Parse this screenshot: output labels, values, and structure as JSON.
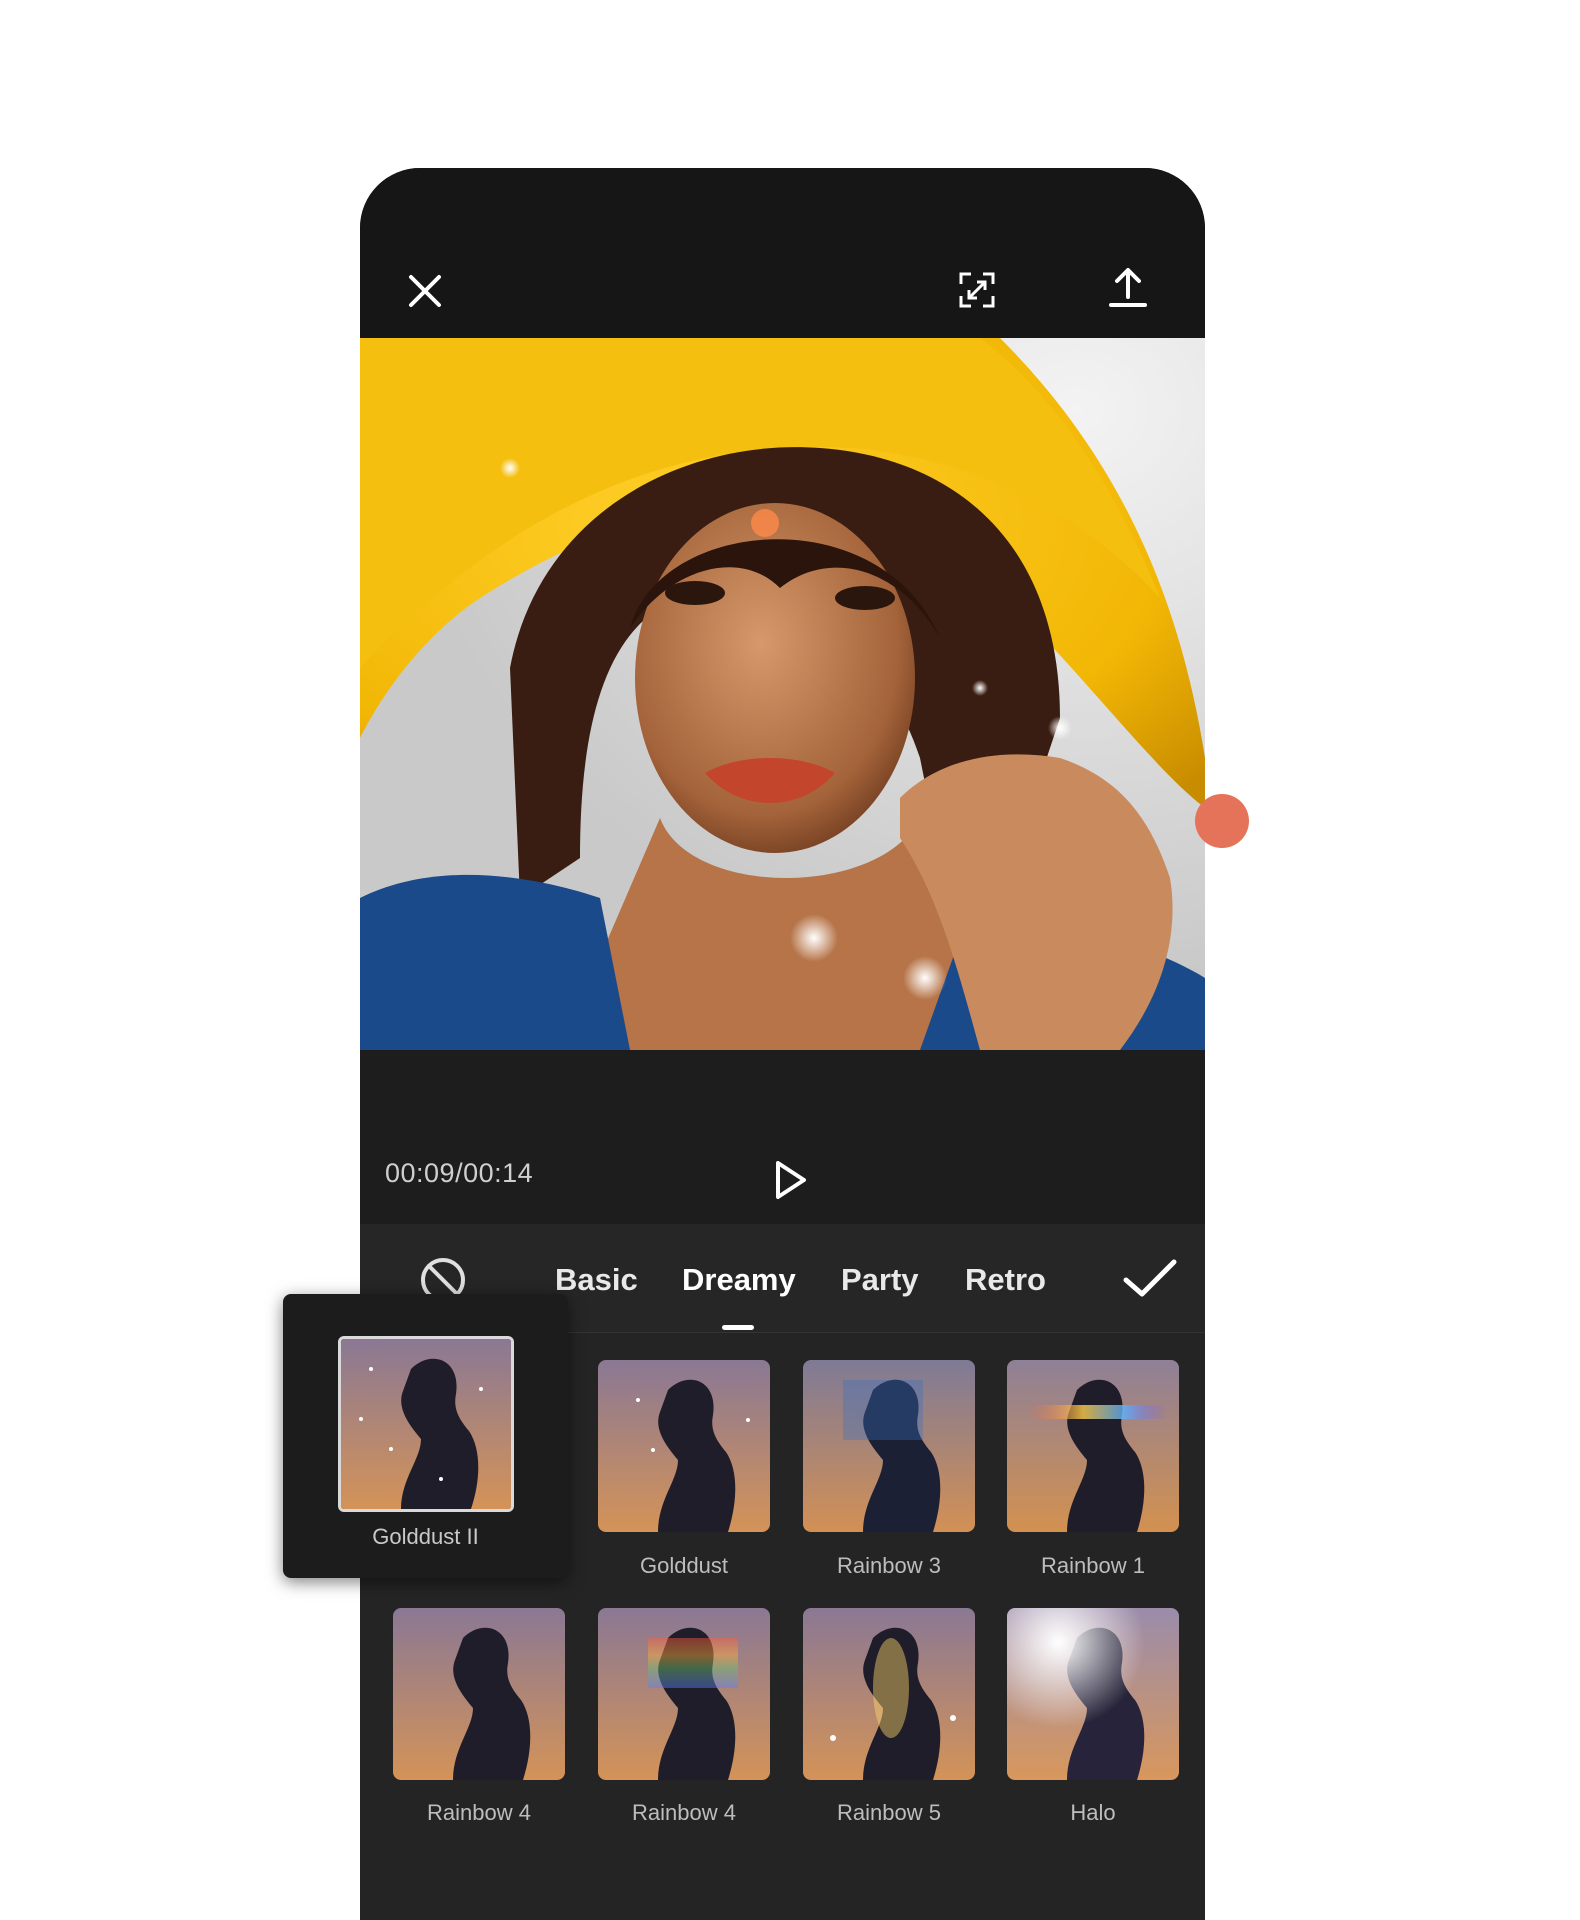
{
  "player": {
    "timecode": "00:09/00:14"
  },
  "filters": {
    "tabs": [
      "Basic",
      "Dreamy",
      "Party",
      "Retro"
    ],
    "active_tab": "Dreamy",
    "items": [
      "Golddust",
      "Rainbow 3",
      "Rainbow 1",
      "Rainbow 4",
      "Rainbow 4",
      "Rainbow 5",
      "Halo"
    ],
    "preview_popup_label": "Golddust II"
  },
  "colors": {
    "background": "#1b1b1b",
    "accent_dot": "#e5735a",
    "hat_yellow": "#f2b705"
  },
  "icons": [
    "close-icon",
    "fullscreen-icon",
    "export-icon",
    "play-icon",
    "no-filter-icon",
    "check-icon"
  ]
}
